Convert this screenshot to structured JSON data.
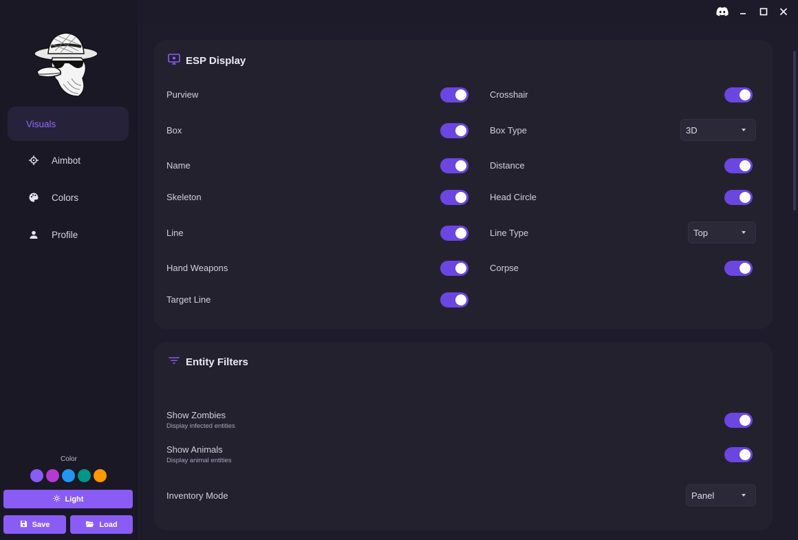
{
  "window": {
    "controls": [
      {
        "name": "discord-icon"
      },
      {
        "name": "minimize-icon"
      },
      {
        "name": "maximize-icon"
      },
      {
        "name": "close-icon"
      }
    ]
  },
  "sidebar": {
    "items": [
      {
        "label": "Visuals",
        "icon": "eye-icon",
        "active": true
      },
      {
        "label": "Aimbot",
        "icon": "crosshair-icon",
        "active": false
      },
      {
        "label": "Colors",
        "icon": "palette-icon",
        "active": false
      },
      {
        "label": "Profile",
        "icon": "person-icon",
        "active": false
      }
    ],
    "color_label": "Color",
    "swatches": [
      "#8a5cf6",
      "#b43bd1",
      "#2196f3",
      "#009688",
      "#ff9800"
    ],
    "light_button": "Light",
    "save_button": "Save",
    "load_button": "Load"
  },
  "esp": {
    "title": "ESP Display",
    "left": [
      {
        "label": "Purview",
        "on": true
      },
      {
        "label": "Box",
        "on": true
      },
      {
        "label": "Name",
        "on": true
      },
      {
        "label": "Skeleton",
        "on": true
      },
      {
        "label": "Line",
        "on": true
      },
      {
        "label": "Hand Weapons",
        "on": true
      },
      {
        "label": "Target Line",
        "on": true
      }
    ],
    "right": {
      "crosshair": {
        "label": "Crosshair",
        "on": true
      },
      "box_type": {
        "label": "Box Type",
        "value": "3D"
      },
      "distance": {
        "label": "Distance",
        "on": true
      },
      "head_circle": {
        "label": "Head Circle",
        "on": true
      },
      "line_type": {
        "label": "Line Type",
        "value": "Top"
      },
      "corpse": {
        "label": "Corpse",
        "on": true
      }
    }
  },
  "filters": {
    "title": "Entity Filters",
    "show_zombies": {
      "label": "Show Zombies",
      "desc": "Display infected entities",
      "on": true
    },
    "show_animals": {
      "label": "Show Animals",
      "desc": "Display animal entities",
      "on": true
    },
    "inventory_mode": {
      "label": "Inventory Mode",
      "value": "Panel"
    }
  },
  "colors": {
    "accent": "#8a5cf6",
    "toggle_on": "#6b46e0",
    "card": "#24212f",
    "background": "#1e1b2b"
  }
}
